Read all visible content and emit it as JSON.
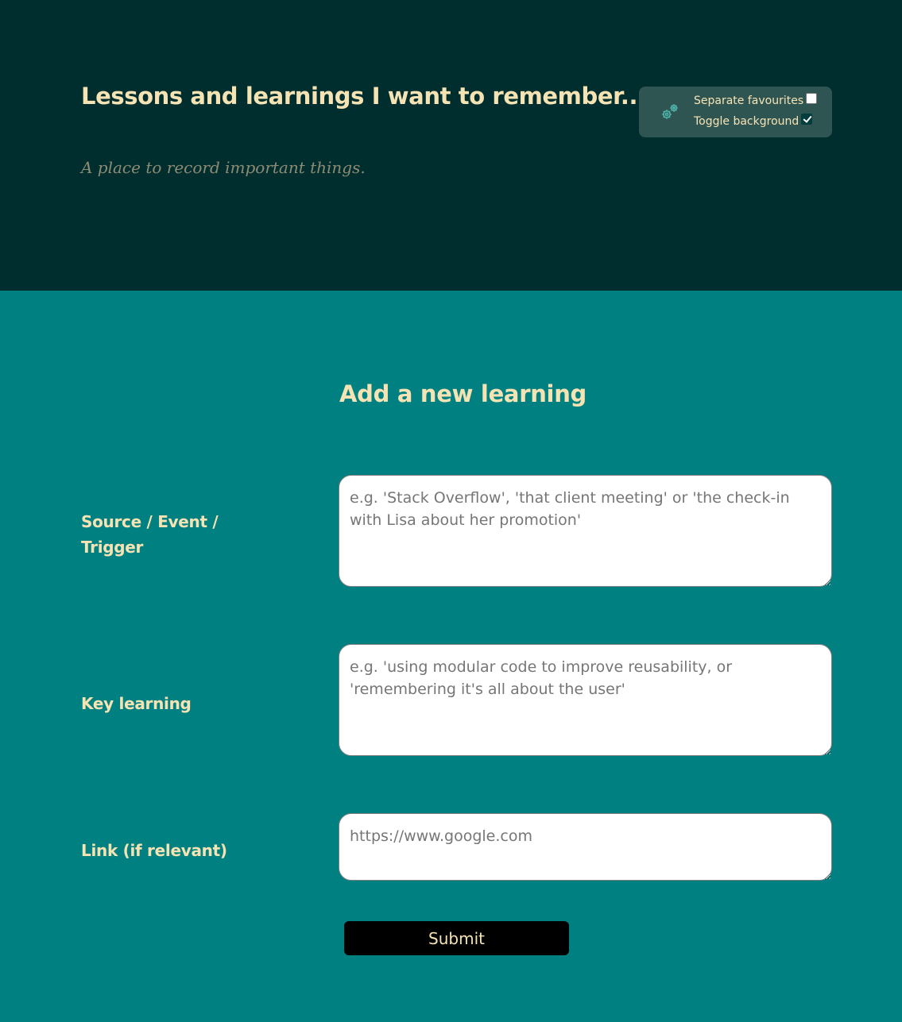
{
  "header": {
    "title": "Lessons and learnings I want to remember...",
    "subtitle": "A place to record important things."
  },
  "settings": {
    "icon": "gears-icon",
    "separate_favourites": {
      "label": "Separate favourites",
      "checked": false
    },
    "toggle_background": {
      "label": "Toggle background",
      "checked": true
    }
  },
  "form": {
    "heading": "Add a new learning",
    "fields": [
      {
        "label": "Source / Event / Trigger",
        "value": "",
        "placeholder": "e.g. 'Stack Overflow', 'that client meeting' or 'the check-in with Lisa about her promotion'"
      },
      {
        "label": "Key learning",
        "value": "",
        "placeholder": "e.g. 'using modular code to improve reusability, or 'remembering it's all about the user'"
      },
      {
        "label": "Link (if relevant)",
        "value": "",
        "placeholder": "https://www.google.com"
      }
    ],
    "submit_label": "Submit"
  },
  "colors": {
    "header_bg": "#002e2f",
    "body_bg": "#008080",
    "accent_text": "#f6e3b4",
    "panel_bg": "#2f5553",
    "icon": "#4fb3a9",
    "button_bg": "#000000"
  }
}
